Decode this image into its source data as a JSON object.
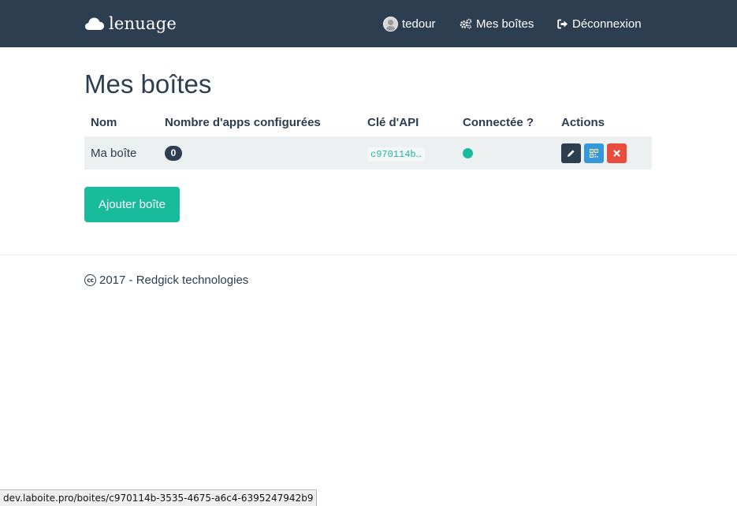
{
  "navbar": {
    "brand": "lenuage",
    "brand_icon": "cloud-icon",
    "user_label": "tedour",
    "boxes_label": "Mes boîtes",
    "logout_label": "Déconnexion",
    "bg_color": "#2c3e50"
  },
  "main": {
    "title": "Mes boîtes",
    "table": {
      "headers": [
        "Nom",
        "Nombre d'apps configurées",
        "Clé d'API",
        "Connectée ?",
        "Actions"
      ],
      "rows": [
        {
          "name": "Ma boîte",
          "apps_count": "0",
          "api_key": "c970114b…",
          "connected": true
        }
      ]
    },
    "add_button_label": "Ajouter boîte",
    "accent_color": "#18bc9c",
    "danger_color": "#e74c3c",
    "info_color": "#3498db"
  },
  "footer": {
    "text": "2017 - Redgick technologies",
    "cc_label": "cc"
  },
  "statusbar": {
    "url": "dev.laboite.pro/boites/c970114b-3535-4675-a6c4-6395247942b9"
  }
}
